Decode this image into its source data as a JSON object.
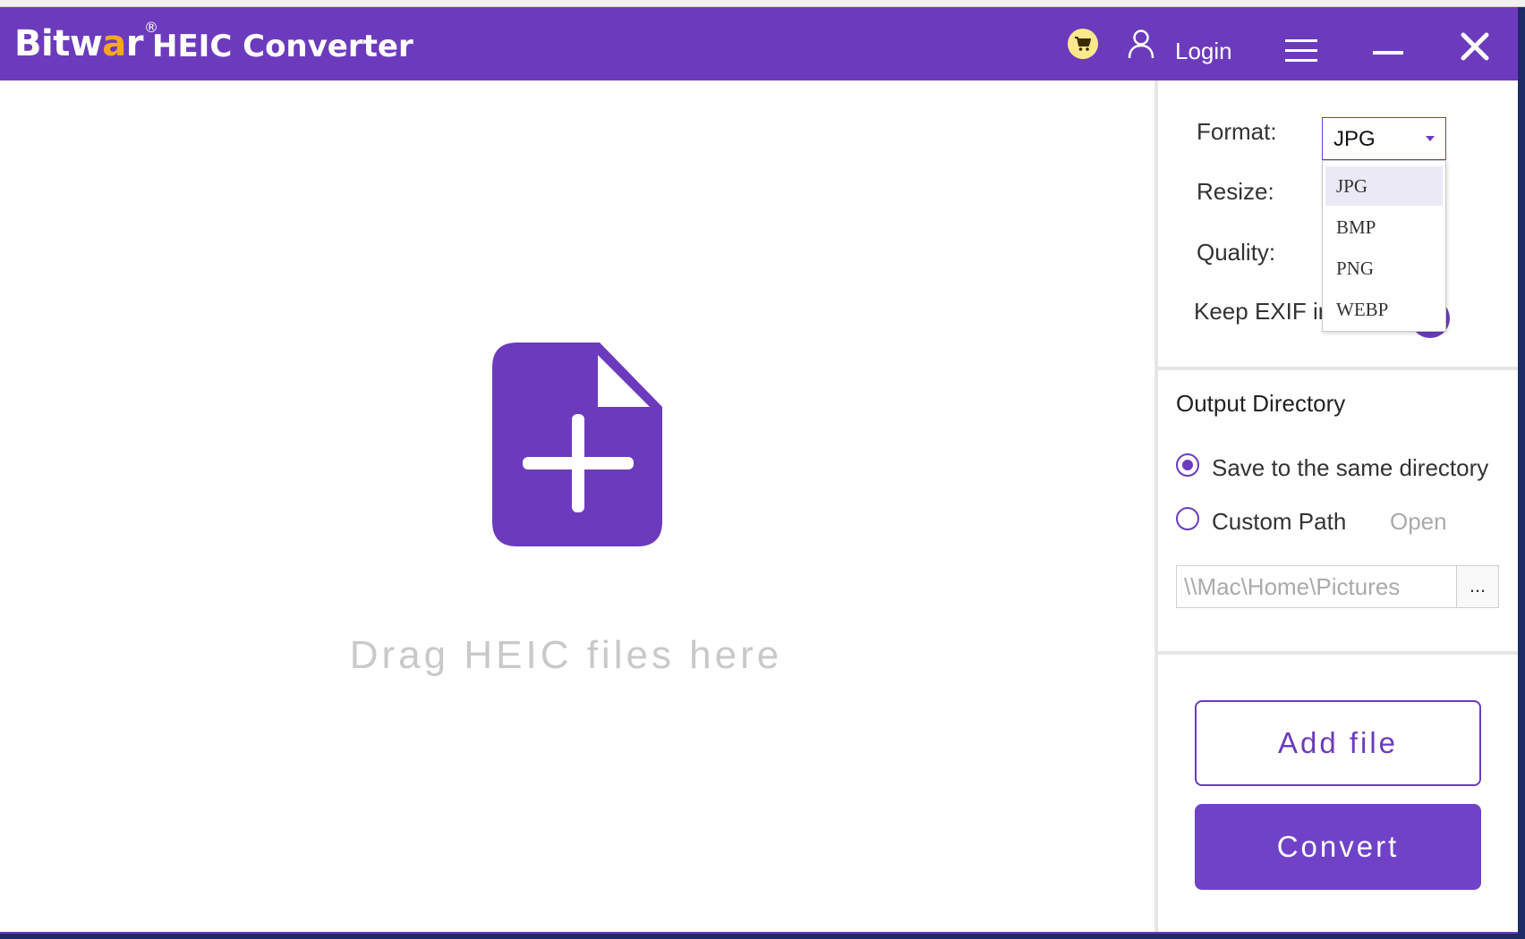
{
  "titlebar": {
    "brand": "Bitw",
    "brand_a": "a",
    "brand_r": "r",
    "registered": "®",
    "title": "HEIC Converter",
    "login_label": "Login"
  },
  "drop_zone": {
    "hint": "Drag HEIC files here"
  },
  "settings": {
    "format_label": "Format:",
    "format_value": "JPG",
    "resize_label": "Resize:",
    "quality_label": "Quality:",
    "exif_label": "Keep EXIF ir",
    "format_options": [
      "JPG",
      "BMP",
      "PNG",
      "WEBP"
    ]
  },
  "output": {
    "title": "Output Directory",
    "same_dir_label": "Save to the same directory",
    "custom_path_label": "Custom Path",
    "open_label": "Open",
    "path_value": "\\\\Mac\\Home\\Pictures",
    "browse_label": "..."
  },
  "actions": {
    "add_file_label": "Add file",
    "convert_label": "Convert"
  },
  "colors": {
    "accent": "#6c3bbd",
    "brand_orange": "#f5a623",
    "cart_yellow": "#fde98c"
  }
}
